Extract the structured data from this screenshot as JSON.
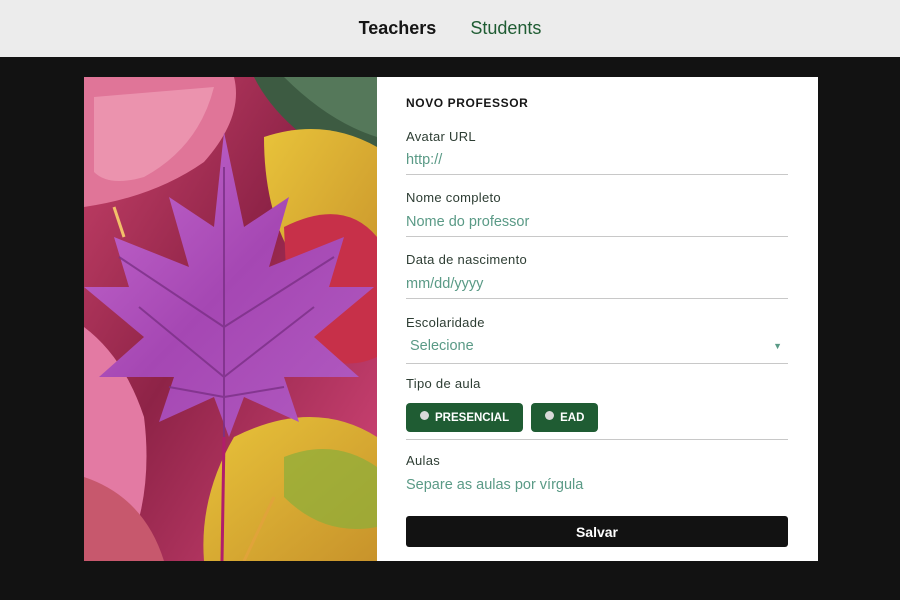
{
  "nav": {
    "teachers": "Teachers",
    "students": "Students",
    "active": "Teachers"
  },
  "form": {
    "title": "NOVO PROFESSOR",
    "avatar": {
      "label": "Avatar URL",
      "placeholder": "http://"
    },
    "name": {
      "label": "Nome completo",
      "placeholder": "Nome do professor"
    },
    "birth": {
      "label": "Data de nascimento",
      "placeholder": "mm/dd/yyyy"
    },
    "education": {
      "label": "Escolaridade",
      "value": "Selecione"
    },
    "class_type": {
      "label": "Tipo de aula",
      "options": [
        "PRESENCIAL",
        "EAD"
      ]
    },
    "lessons": {
      "label": "Aulas",
      "placeholder": "Separe as aulas por vírgula"
    },
    "save": "Salvar"
  },
  "colors": {
    "accent_green": "#1f5c33",
    "field_text": "#5a9a86",
    "background": "#121212",
    "nav_background": "#ececec"
  },
  "icons": {
    "select_caret": "caret-down-icon",
    "radio": "radio-unchecked-icon"
  }
}
